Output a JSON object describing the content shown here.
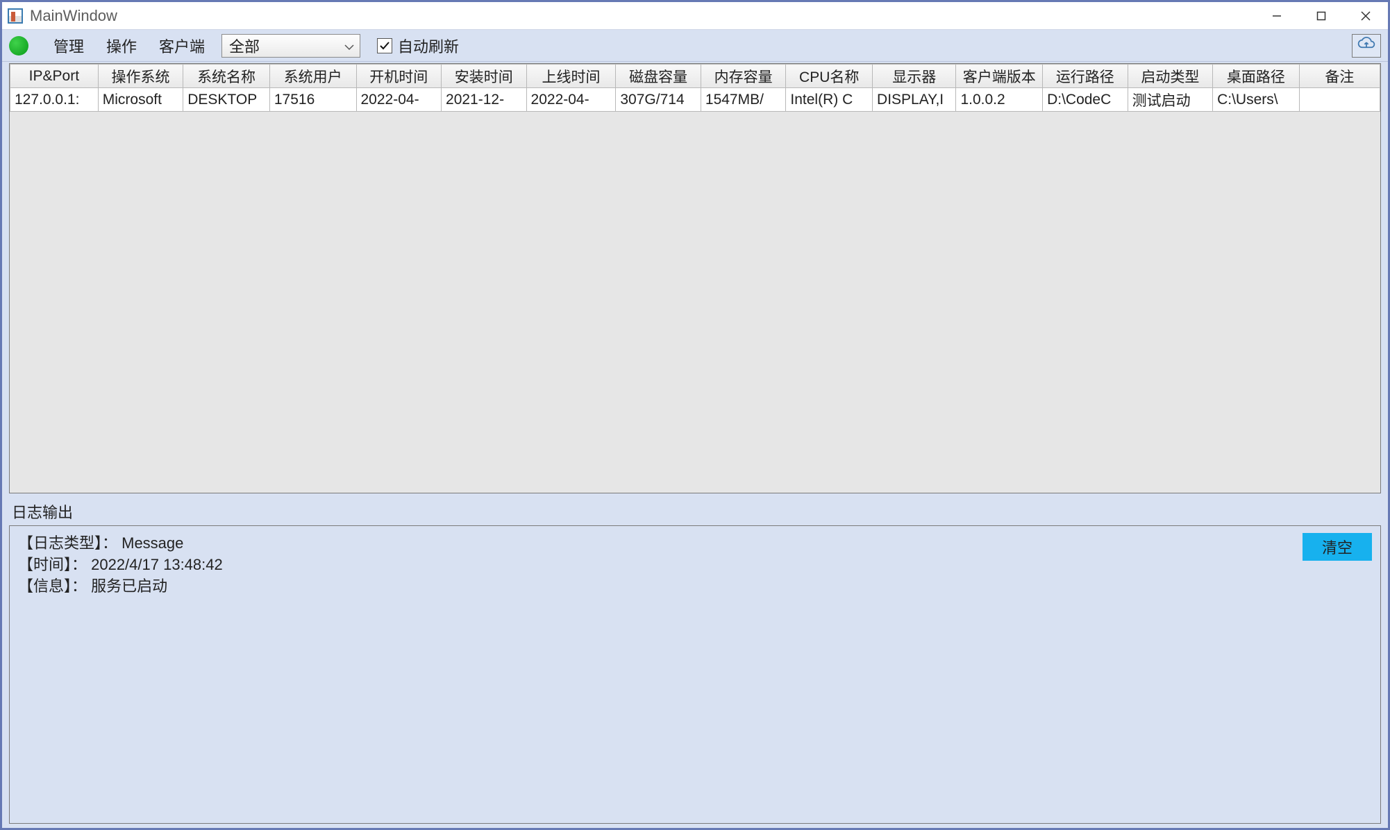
{
  "window": {
    "title": "MainWindow"
  },
  "toolbar": {
    "menu": {
      "manage": "管理",
      "action": "操作",
      "client": "客户端"
    },
    "filter_selected": "全部",
    "auto_refresh_label": "自动刷新",
    "auto_refresh_checked": true
  },
  "grid": {
    "columns": [
      "IP&Port",
      "操作系统",
      "系统名称",
      "系统用户",
      "开机时间",
      "安装时间",
      "上线时间",
      "磁盘容量",
      "内存容量",
      "CPU名称",
      "显示器",
      "客户端版本",
      "运行路径",
      "启动类型",
      "桌面路径",
      "备注"
    ],
    "rows": [
      {
        "ip_port": "127.0.0.1:",
        "os": "Microsoft",
        "sys_name": "DESKTOP",
        "sys_user": "17516",
        "boot_time": "2022-04-",
        "install_time": "2021-12-",
        "online_time": "2022-04-",
        "disk": "307G/714",
        "memory": "1547MB/",
        "cpu": "Intel(R) C",
        "display": "DISPLAY,I",
        "client_ver": "1.0.0.2",
        "run_path": "D:\\CodeC",
        "start_type": "测试启动",
        "desktop_path": "C:\\Users\\",
        "remark": ""
      }
    ]
  },
  "log": {
    "title": "日志输出",
    "lines": [
      "【日志类型】： Message",
      "【时间】： 2022/4/17 13:48:42",
      "【信息】： 服务已启动"
    ],
    "clear_label": "清空"
  }
}
